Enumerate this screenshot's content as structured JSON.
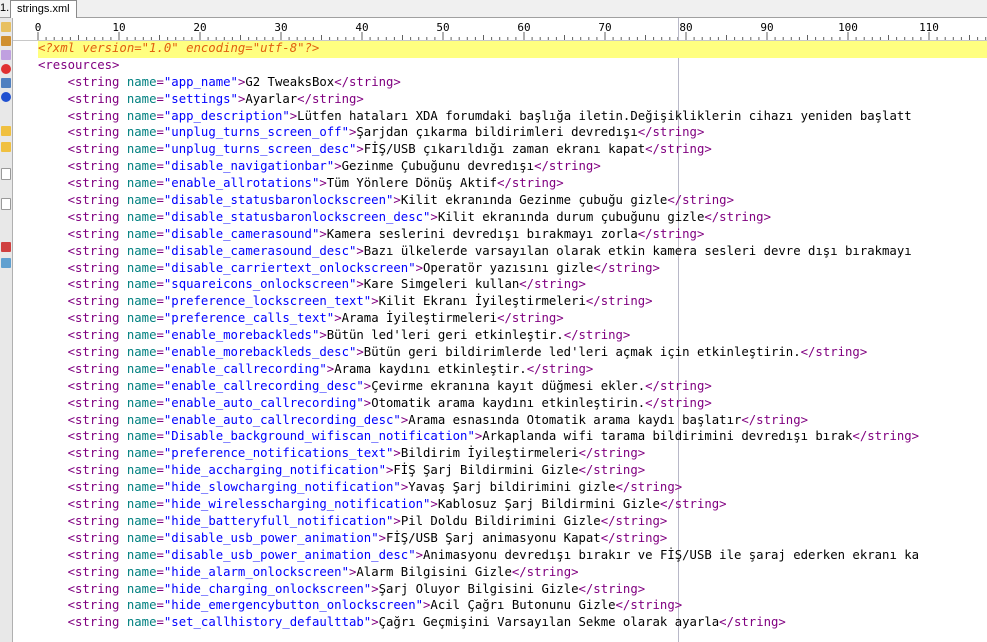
{
  "tabs": {
    "prev_label": "1...",
    "active_label": "strings.xml"
  },
  "ruler": {
    "labels": [
      "0",
      "10",
      "20",
      "30",
      "40",
      "50",
      "60",
      "70",
      "80",
      "90",
      "100",
      "110"
    ]
  },
  "xml": {
    "declaration": "<?xml version=\"1.0\" encoding=\"utf-8\"?>",
    "root_open": "<resources>",
    "open_tag": "<string",
    "attr_name": "name",
    "close_tag": "</string>",
    "entries": [
      {
        "name": "app_name",
        "text": "G2 TweaksBox",
        "closed": true
      },
      {
        "name": "settings",
        "text": "Ayarlar",
        "closed": true
      },
      {
        "name": "app_description",
        "text": "Lütfen hataları XDA forumdaki başlığa iletin.Değişikliklerin cihazı yeniden başlatt",
        "closed": false
      },
      {
        "name": "unplug_turns_screen_off",
        "text": "Şarjdan çıkarma bildirimleri devredışı",
        "closed": true
      },
      {
        "name": "unplug_turns_screen_desc",
        "text": "FİŞ/USB çıkarıldığı zaman ekranı kapat",
        "closed": true
      },
      {
        "name": "disable_navigationbar",
        "text": "Gezinme Çubuğunu devredışı",
        "closed": true
      },
      {
        "name": "enable_allrotations",
        "text": "Tüm Yönlere Dönüş Aktif",
        "closed": true
      },
      {
        "name": "disable_statusbaronlockscreen",
        "text": "Kilit ekranında Gezinme çubuğu gizle",
        "closed": true
      },
      {
        "name": "disable_statusbaronlockscreen_desc",
        "text": "Kilit ekranında durum çubuğunu gizle",
        "closed": true
      },
      {
        "name": "disable_camerasound",
        "text": "Kamera seslerini devredışı bırakmayı zorla",
        "closed": true
      },
      {
        "name": "disable_camerasound_desc",
        "text": "Bazı ülkelerde varsayılan olarak etkin kamera sesleri devre dışı bırakmayı",
        "closed": false
      },
      {
        "name": "disable_carriertext_onlockscreen",
        "text": "Operatör yazısını gizle",
        "closed": true
      },
      {
        "name": "squareicons_onlockscreen",
        "text": "Kare Simgeleri kullan",
        "closed": true
      },
      {
        "name": "preference_lockscreen_text",
        "text": "Kilit Ekranı İyileştirmeleri",
        "closed": true
      },
      {
        "name": "preference_calls_text",
        "text": "Arama İyileştirmeleri",
        "closed": true
      },
      {
        "name": "enable_morebackleds",
        "text": "Bütün led'leri geri etkinleştir.",
        "closed": true
      },
      {
        "name": "enable_morebackleds_desc",
        "text": "Bütün geri bildirimlerde led'leri açmak için etkinleştirin.",
        "closed": true
      },
      {
        "name": "enable_callrecording",
        "text": "Arama kaydını etkinleştir.",
        "closed": true
      },
      {
        "name": "enable_callrecording_desc",
        "text": "Çevirme ekranına kayıt düğmesi ekler.",
        "closed": true
      },
      {
        "name": "enable_auto_callrecording",
        "text": "Otomatik arama kaydını etkinleştirin.",
        "closed": true
      },
      {
        "name": "enable_auto_callrecording_desc",
        "text": "Arama esnasında Otomatik arama kaydı başlatır",
        "closed": true
      },
      {
        "name": "Disable_background_wifiscan_notification",
        "text": "Arkaplanda wifi tarama bildirimini devredışı bırak",
        "closed": true
      },
      {
        "name": "preference_notifications_text",
        "text": "Bildirim İyileştirmeleri",
        "closed": true
      },
      {
        "name": "hide_accharging_notification",
        "text": "FİŞ Şarj Bildirmini Gizle",
        "closed": true
      },
      {
        "name": "hide_slowcharging_notification",
        "text": "Yavaş Şarj bildirimini gizle",
        "closed": true
      },
      {
        "name": "hide_wirelesscharging_notification",
        "text": "Kablosuz Şarj Bildirmini Gizle",
        "closed": true
      },
      {
        "name": "hide_batteryfull_notification",
        "text": "Pil Doldu Bildirimini Gizle",
        "closed": true
      },
      {
        "name": "disable_usb_power_animation",
        "text": "FİŞ/USB Şarj animasyonu Kapat",
        "closed": true
      },
      {
        "name": "disable_usb_power_animation_desc",
        "text": "Animasyonu devredışı bırakır ve FİŞ/USB ile şaraj ederken ekranı ka",
        "closed": false
      },
      {
        "name": "hide_alarm_onlockscreen",
        "text": "Alarm Bilgisini Gizle",
        "closed": true
      },
      {
        "name": "hide_charging_onlockscreen",
        "text": "Şarj Oluyor Bilgisini Gizle",
        "closed": true
      },
      {
        "name": "hide_emergencybutton_onlockscreen",
        "text": "Acil Çağrı Butonunu Gizle",
        "closed": true
      },
      {
        "name": "set_callhistory_defaulttab",
        "text": "Çağrı Geçmişini Varsayılan Sekme olarak ayarla",
        "closed": true
      }
    ]
  },
  "colors": {
    "tag": "#800080",
    "attribute": "#008080",
    "value": "#0000ff",
    "declaration": "#e06010",
    "highlight": "#ffff80"
  }
}
